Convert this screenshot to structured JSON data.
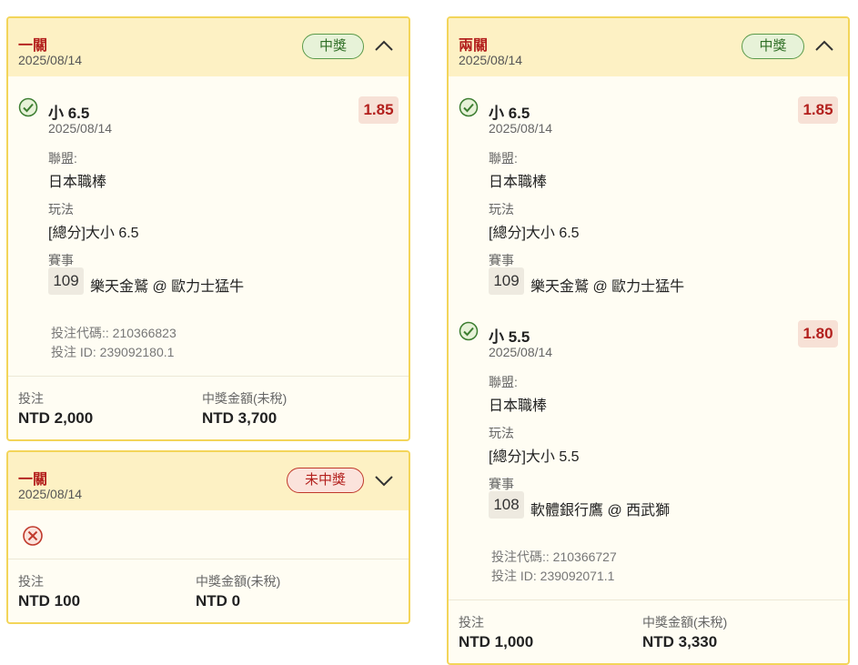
{
  "colors": {
    "accent_red": "#b3201d",
    "win_green": "#2f6e25",
    "header_bg": "#fdf1c4",
    "border": "#f3d55a"
  },
  "labels": {
    "league": "聯盟:",
    "play": "玩法",
    "match": "賽事",
    "stake": "投注",
    "payout": "中獎金額(未稅)"
  },
  "cards": [
    {
      "title": "一關",
      "date": "2025/08/14",
      "status": "中獎",
      "expanded": true,
      "selections": [
        {
          "name": "小 6.5",
          "date": "2025/08/14",
          "odds": "1.85",
          "league": "日本職棒",
          "play": "[總分]大小 6.5",
          "match_no": "109",
          "match_name": "樂天金鷲 @ 歐力士猛牛"
        }
      ],
      "bet_code": "投注代碼:: 210366823",
      "bet_id": "投注 ID: 239092180.1",
      "stake": "NTD 2,000",
      "payout": "NTD 3,700"
    },
    {
      "title": "一關",
      "date": "2025/08/14",
      "status": "未中獎",
      "expanded": false,
      "stake": "NTD 100",
      "payout": "NTD 0"
    },
    {
      "title": "兩關",
      "date": "2025/08/14",
      "status": "中獎",
      "expanded": true,
      "selections": [
        {
          "name": "小 6.5",
          "date": "2025/08/14",
          "odds": "1.85",
          "league": "日本職棒",
          "play": "[總分]大小 6.5",
          "match_no": "109",
          "match_name": "樂天金鷲 @ 歐力士猛牛"
        },
        {
          "name": "小 5.5",
          "date": "2025/08/14",
          "odds": "1.80",
          "league": "日本職棒",
          "play": "[總分]大小 5.5",
          "match_no": "108",
          "match_name": "軟體銀行鷹 @ 西武獅"
        }
      ],
      "bet_code": "投注代碼:: 210366727",
      "bet_id": "投注 ID: 239092071.1",
      "stake": "NTD 1,000",
      "payout": "NTD 3,330"
    }
  ]
}
